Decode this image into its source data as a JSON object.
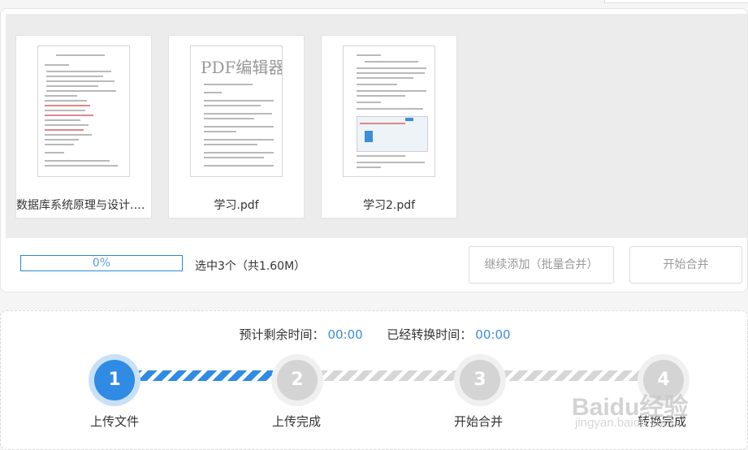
{
  "files": [
    {
      "name": "数据库系统原理与设计.p..."
    },
    {
      "name": "学习.pdf",
      "thumb_watermark": "PDF编辑器"
    },
    {
      "name": "学习2.pdf"
    }
  ],
  "progress": {
    "text": "0%",
    "value": 0
  },
  "selection": {
    "text": "选中3个（共1.60M）"
  },
  "buttons": {
    "continue_add": "继续添加（批量合并）",
    "start_merge": "开始合并"
  },
  "timing": {
    "remaining_label": "预计剩余时间：",
    "remaining_value": "00:00",
    "elapsed_label": "已经转换时间：",
    "elapsed_value": "00:00"
  },
  "steps": [
    {
      "number": "1",
      "label": "上传文件",
      "active": true
    },
    {
      "number": "2",
      "label": "上传完成",
      "active": false
    },
    {
      "number": "3",
      "label": "开始合并",
      "active": false
    },
    {
      "number": "4",
      "label": "转换完成",
      "active": false
    }
  ],
  "watermark": {
    "brand": "Baidu经验",
    "url": "jingyan.baidu.com"
  },
  "colors": {
    "accent": "#2f8be4",
    "inactive": "#d4d4d4"
  }
}
